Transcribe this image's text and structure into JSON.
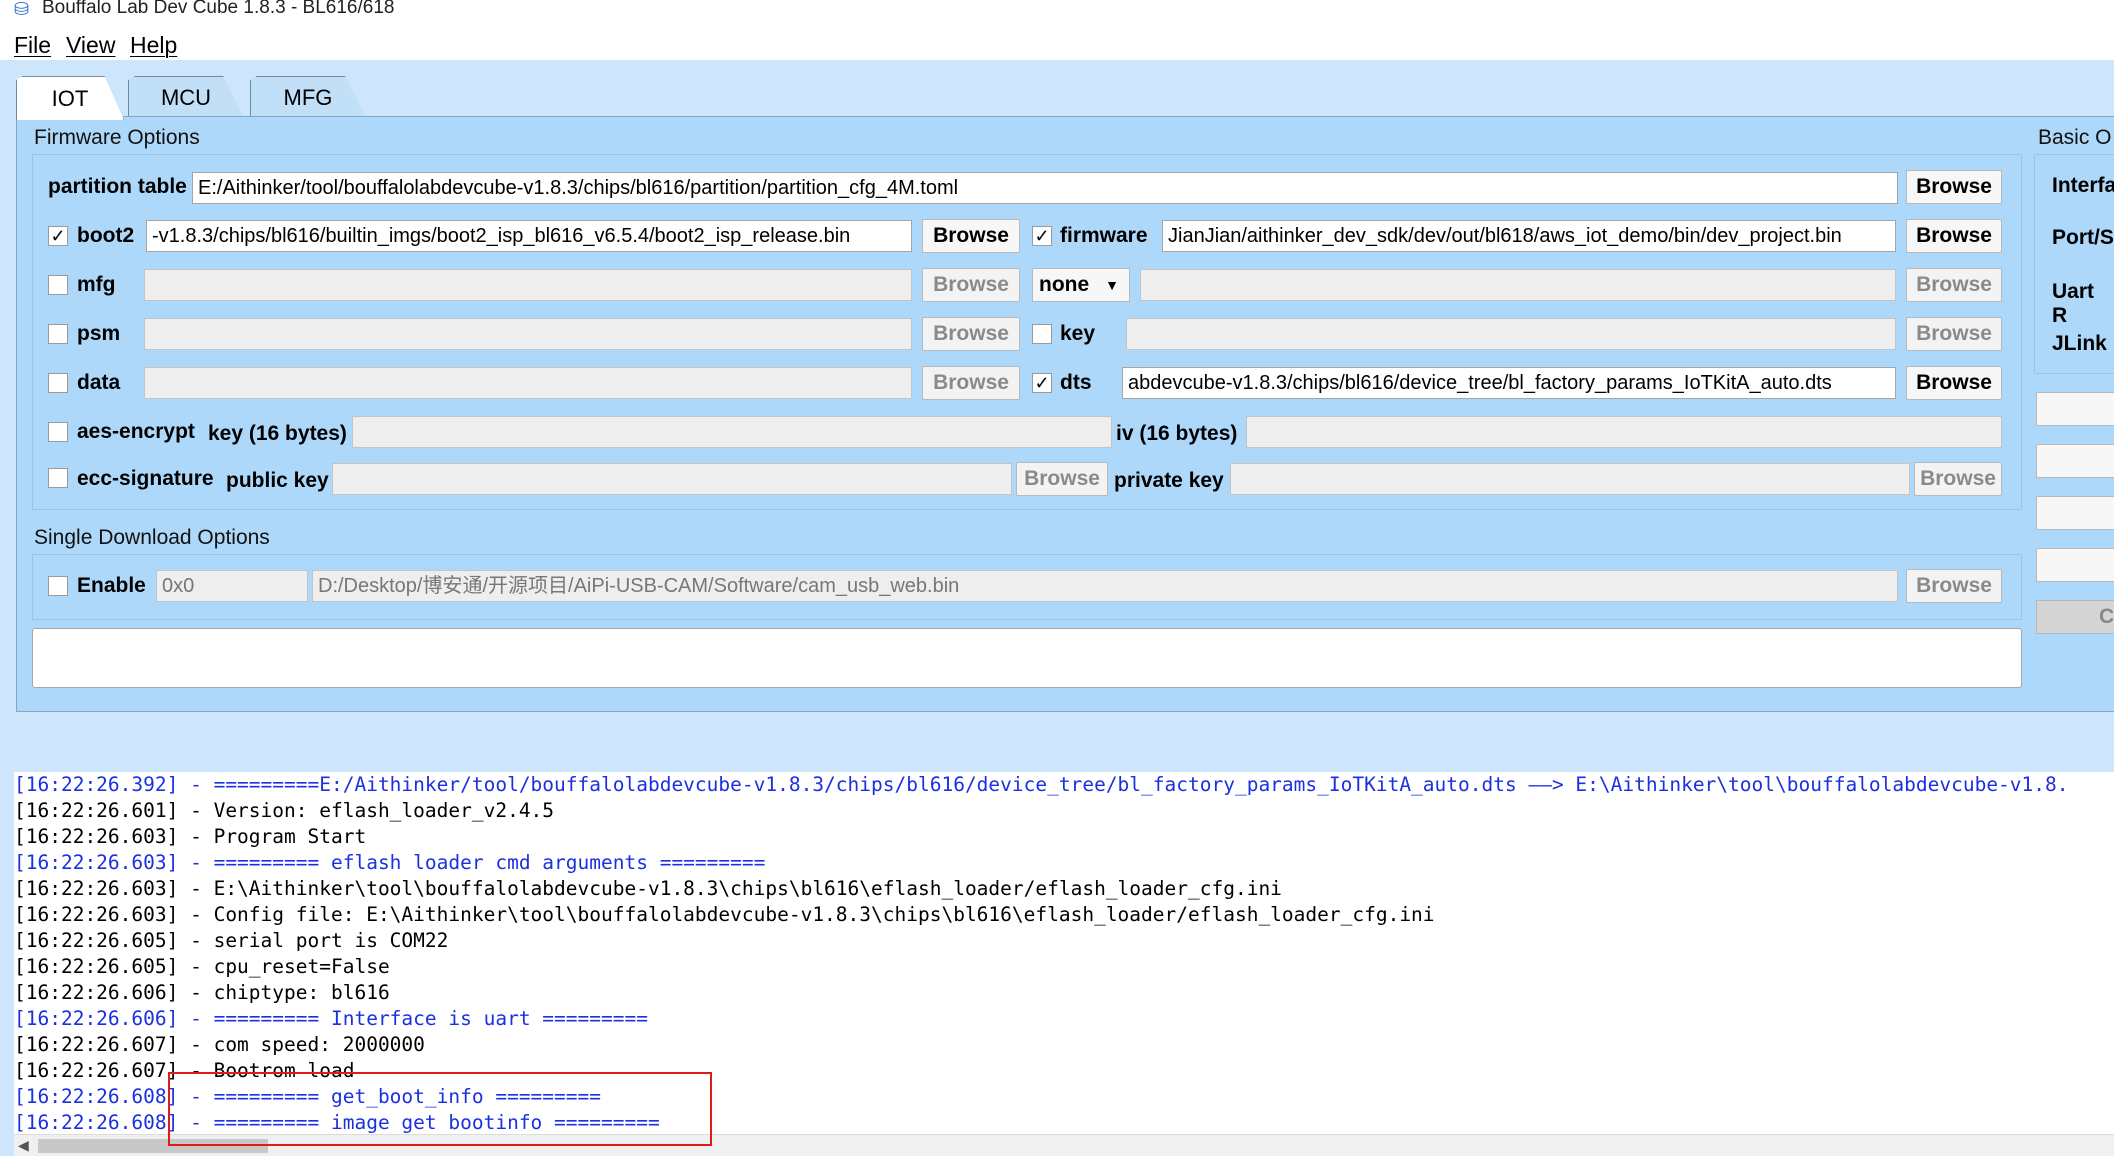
{
  "window": {
    "title": "Bouffalo Lab Dev Cube 1.8.3 - BL616/618"
  },
  "menu": [
    "File",
    "View",
    "Help"
  ],
  "tabs": [
    {
      "label": "IOT",
      "active": true
    },
    {
      "label": "MCU",
      "active": false
    },
    {
      "label": "MFG",
      "active": false
    }
  ],
  "firmware": {
    "group_label": "Firmware Options",
    "partition_table": {
      "label": "partition table",
      "value": "E:/Aithinker/tool/bouffalolabdevcube-v1.8.3/chips/bl616/partition/partition_cfg_4M.toml",
      "button": "Browse"
    },
    "boot2": {
      "label": "boot2",
      "checked": true,
      "value": "-v1.8.3/chips/bl616/builtin_imgs/boot2_isp_bl616_v6.5.4/boot2_isp_release.bin",
      "button": "Browse"
    },
    "firmware": {
      "label": "firmware",
      "checked": true,
      "value": "JianJian/aithinker_dev_sdk/dev/out/bl618/aws_iot_demo/bin/dev_project.bin",
      "button": "Browse"
    },
    "mfg": {
      "label": "mfg",
      "checked": false,
      "value": "",
      "button": "Browse",
      "select": "none",
      "value2": "",
      "button2": "Browse"
    },
    "psm": {
      "label": "psm",
      "checked": false,
      "value": "",
      "button": "Browse"
    },
    "key": {
      "label": "key",
      "checked": false,
      "value": "",
      "button": "Browse"
    },
    "data": {
      "label": "data",
      "checked": false,
      "value": "",
      "button": "Browse"
    },
    "dts": {
      "label": "dts",
      "checked": true,
      "value": "abdevcube-v1.8.3/chips/bl616/device_tree/bl_factory_params_IoTKitA_auto.dts",
      "button": "Browse"
    },
    "aes": {
      "label": "aes-encrypt",
      "checked": false,
      "key_label": "key (16 bytes)",
      "key": "",
      "iv_label": "iv (16 bytes)",
      "iv": ""
    },
    "ecc": {
      "label": "ecc-signature",
      "checked": false,
      "public_label": "public key",
      "public": "",
      "public_button": "Browse",
      "private_label": "private key",
      "private": "",
      "private_button": "Browse"
    }
  },
  "single": {
    "group_label": "Single Download Options",
    "enable_label": "Enable",
    "checked": false,
    "address": "0x0",
    "path": "D:/Desktop/博安通/开源项目/AiPi-USB-CAM/Software/cam_usb_web.bin",
    "button": "Browse"
  },
  "basic": {
    "group_label": "Basic O",
    "labels": [
      "Interfa",
      "Port/S",
      "Uart R",
      "JLink"
    ],
    "partial_button": "C"
  },
  "log": [
    {
      "text": "[16:22:26.392] - =========E:/Aithinker/tool/bouffalolabdevcube-v1.8.3/chips/bl616/device_tree/bl_factory_params_IoTKitA_auto.dts ——> E:\\Aithinker\\tool\\bouffalolabdevcube-v1.8.",
      "color": "blue"
    },
    {
      "text": "[16:22:26.601] - Version: eflash_loader_v2.4.5",
      "color": "black"
    },
    {
      "text": "[16:22:26.603] - Program Start",
      "color": "black"
    },
    {
      "text": "[16:22:26.603] - ========= eflash loader cmd arguments =========",
      "color": "blue"
    },
    {
      "text": "[16:22:26.603] - E:\\Aithinker\\tool\\bouffalolabdevcube-v1.8.3\\chips\\bl616\\eflash_loader/eflash_loader_cfg.ini",
      "color": "black"
    },
    {
      "text": "[16:22:26.603] - Config file: E:\\Aithinker\\tool\\bouffalolabdevcube-v1.8.3\\chips\\bl616\\eflash_loader/eflash_loader_cfg.ini",
      "color": "black"
    },
    {
      "text": "[16:22:26.605] - serial port is COM22",
      "color": "black"
    },
    {
      "text": "[16:22:26.605] - cpu_reset=False",
      "color": "black"
    },
    {
      "text": "[16:22:26.606] - chiptype: bl616",
      "color": "black"
    },
    {
      "text": "[16:22:26.606] - ========= Interface is uart =========",
      "color": "blue"
    },
    {
      "text": "[16:22:26.607] - com speed: 2000000",
      "color": "black"
    },
    {
      "text": "[16:22:26.607] - Bootrom load",
      "color": "black"
    },
    {
      "text": "[16:22:26.608] - ========= get_boot_info =========",
      "color": "blue"
    },
    {
      "text": "[16:22:26.608] - ========= image get bootinfo =========",
      "color": "blue"
    }
  ]
}
